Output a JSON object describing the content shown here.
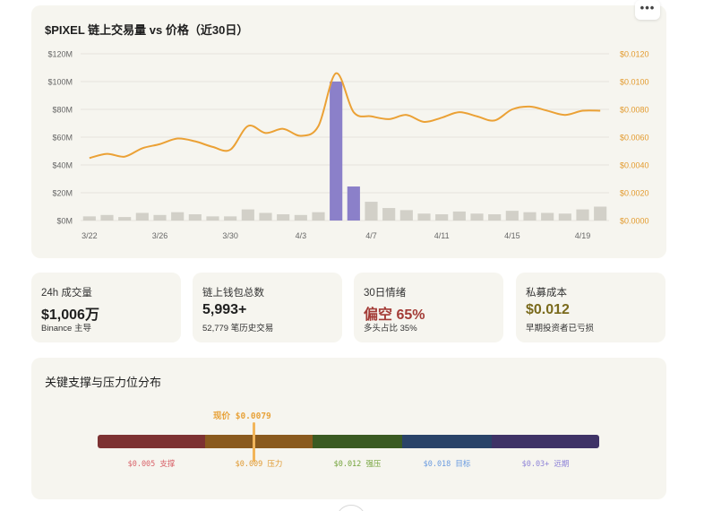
{
  "chart_card": {
    "title": "$PIXEL 链上交易量 vs 价格（近30日）",
    "more_label": "•••"
  },
  "chart_data": {
    "type": "bar+line",
    "title": "$PIXEL 链上交易量 vs 价格（近30日）",
    "x_tick_labels": [
      "3/22",
      "3/26",
      "3/30",
      "4/3",
      "4/7",
      "4/11",
      "4/15",
      "4/19"
    ],
    "left_axis": {
      "ticks": [
        "$0M",
        "$20M",
        "$40M",
        "$60M",
        "$80M",
        "$100M",
        "$120M"
      ],
      "ylim": [
        0,
        120
      ],
      "unit": "M"
    },
    "right_axis": {
      "ticks": [
        "$0.0000",
        "$0.0020",
        "$0.0040",
        "$0.0060",
        "$0.0080",
        "$0.0100",
        "$0.0120"
      ],
      "ylim": [
        0,
        0.012
      ]
    },
    "grid": true,
    "series": [
      {
        "kind": "bar",
        "axis": "left",
        "values": [
          3,
          4,
          2.5,
          5.5,
          4,
          6,
          4.5,
          3,
          3,
          8,
          5.5,
          4.5,
          4,
          6,
          100,
          24.5,
          13.5,
          9,
          7.5,
          5,
          4.5,
          6.5,
          5,
          4.5,
          7,
          6,
          5.5,
          5,
          8,
          10
        ],
        "highlight_colors": {
          "14": "#8b80c9",
          "15": "#8b80c9"
        },
        "color": "#d2d0c8"
      },
      {
        "kind": "line",
        "axis": "right",
        "color": "#eba135",
        "values": [
          0.0045,
          0.0048,
          0.0046,
          0.0052,
          0.0055,
          0.0059,
          0.0057,
          0.0053,
          0.0051,
          0.0068,
          0.0063,
          0.0066,
          0.0061,
          0.0068,
          0.0106,
          0.0078,
          0.0075,
          0.0073,
          0.0076,
          0.0071,
          0.0074,
          0.0078,
          0.0075,
          0.0072,
          0.008,
          0.0082,
          0.0079,
          0.0076,
          0.0079,
          0.0079
        ]
      }
    ]
  },
  "stats": [
    {
      "label": "24h 成交量",
      "value": "$1,006万",
      "sub": "Binance 主导",
      "value_color": "#1f1f1f"
    },
    {
      "label": "链上钱包总数",
      "value": "5,993+",
      "sub": "52,779 笔历史交易",
      "value_color": "#1f1f1f"
    },
    {
      "label": "30日情绪",
      "value": "偏空 65%",
      "sub": "多头占比 35%",
      "value_color": "#a33b36"
    },
    {
      "label": "私募成本",
      "value": "$0.012",
      "sub": "早期投资者已亏损",
      "value_color": "#7a6a1c"
    }
  ],
  "levels": {
    "title": "关键支撑与压力位分布",
    "current_label": "现价 $0.0079",
    "segments": [
      {
        "label": "$0.005 支撑",
        "color": "#7d3232",
        "label_color": "#d9646b"
      },
      {
        "label": "$0.009 压力",
        "color": "#8a5a1e",
        "label_color": "#e09a33"
      },
      {
        "label": "$0.012 强压",
        "color": "#3a5a22",
        "label_color": "#74a43c"
      },
      {
        "label": "$0.018 目标",
        "color": "#2a4368",
        "label_color": "#6a9be0"
      },
      {
        "label": "$0.03+ 远期",
        "color": "#3f3366",
        "label_color": "#8f84d8"
      }
    ]
  }
}
